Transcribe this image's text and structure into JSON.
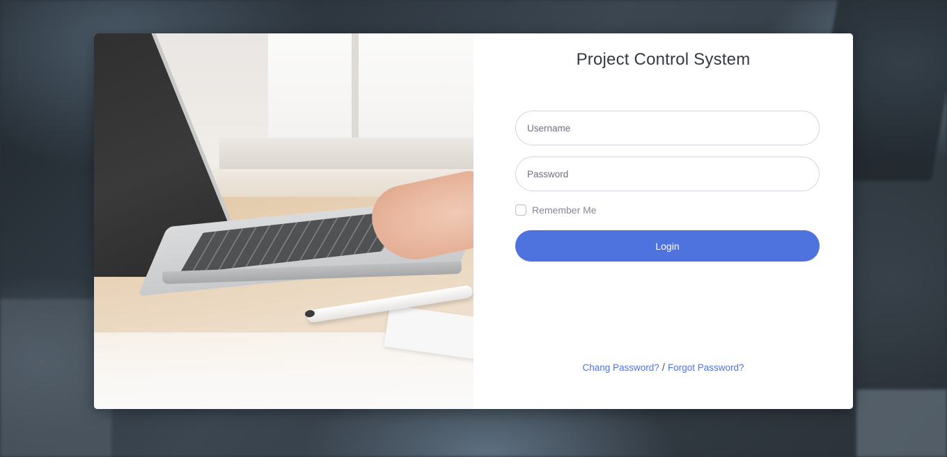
{
  "form": {
    "title": "Project Control System",
    "username_placeholder": "Username",
    "password_placeholder": "Password",
    "remember_label": "Remember Me",
    "login_label": "Login"
  },
  "links": {
    "change_password": "Chang Password?",
    "separator": "/",
    "forgot_password": "Forgot Password?"
  },
  "colors": {
    "primary": "#4e73df",
    "title": "#333a44",
    "muted": "#858796"
  }
}
